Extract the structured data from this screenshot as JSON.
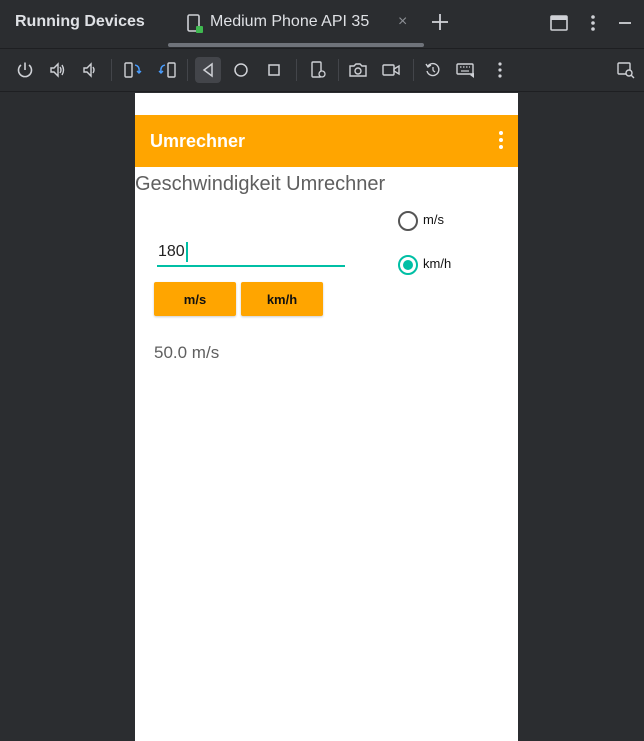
{
  "ide": {
    "panel_title": "Running Devices",
    "tab_label": "Medium Phone API 35",
    "tab_close": "×",
    "toolbar_icons": [
      "power-icon",
      "volume-up-icon",
      "volume-down-icon",
      "rotate-left-icon",
      "rotate-right-icon",
      "back-icon",
      "home-icon",
      "overview-icon",
      "device-settings-icon",
      "camera-icon",
      "screen-record-icon",
      "reset-icon",
      "keyboard-icon",
      "more-vert-icon"
    ]
  },
  "app": {
    "title": "Umrechner",
    "heading": "Geschwindigkeit Umrechner",
    "input_value": "180",
    "button_ms": "m/s",
    "button_kmh": "km/h",
    "radio_ms": "m/s",
    "radio_kmh": "km/h",
    "selected_radio": "km/h",
    "result": "50.0 m/s"
  },
  "colors": {
    "accent_orange": "#ffa500",
    "accent_teal": "#00bfa5",
    "ide_background": "#2b2d30"
  }
}
